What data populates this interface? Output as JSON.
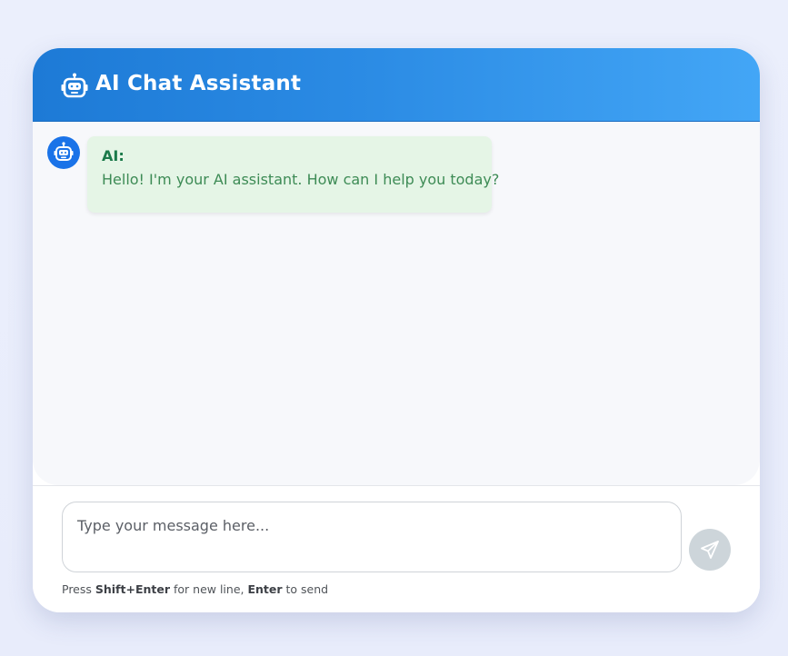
{
  "header": {
    "icon": "robot-icon",
    "title": "AI Chat Assistant"
  },
  "messages": [
    {
      "avatar_icon": "robot-icon",
      "sender": "AI:",
      "text": "Hello! I'm your AI assistant. How can I help you today?"
    }
  ],
  "composer": {
    "placeholder": "Type your message here...",
    "value": "",
    "send_icon": "paper-plane-icon",
    "hint": {
      "prefix": "Press ",
      "key1": "Shift+Enter",
      "middle": " for new line, ",
      "key2": "Enter",
      "suffix": " to send"
    }
  },
  "colors": {
    "header_gradient_start": "#1d7ad6",
    "header_gradient_end": "#43a6f6",
    "ai_bubble": "#e5f5e6",
    "ai_sender": "#1b7a4a",
    "ai_text": "#3d8b55",
    "send_button_disabled": "#cdd5da"
  }
}
